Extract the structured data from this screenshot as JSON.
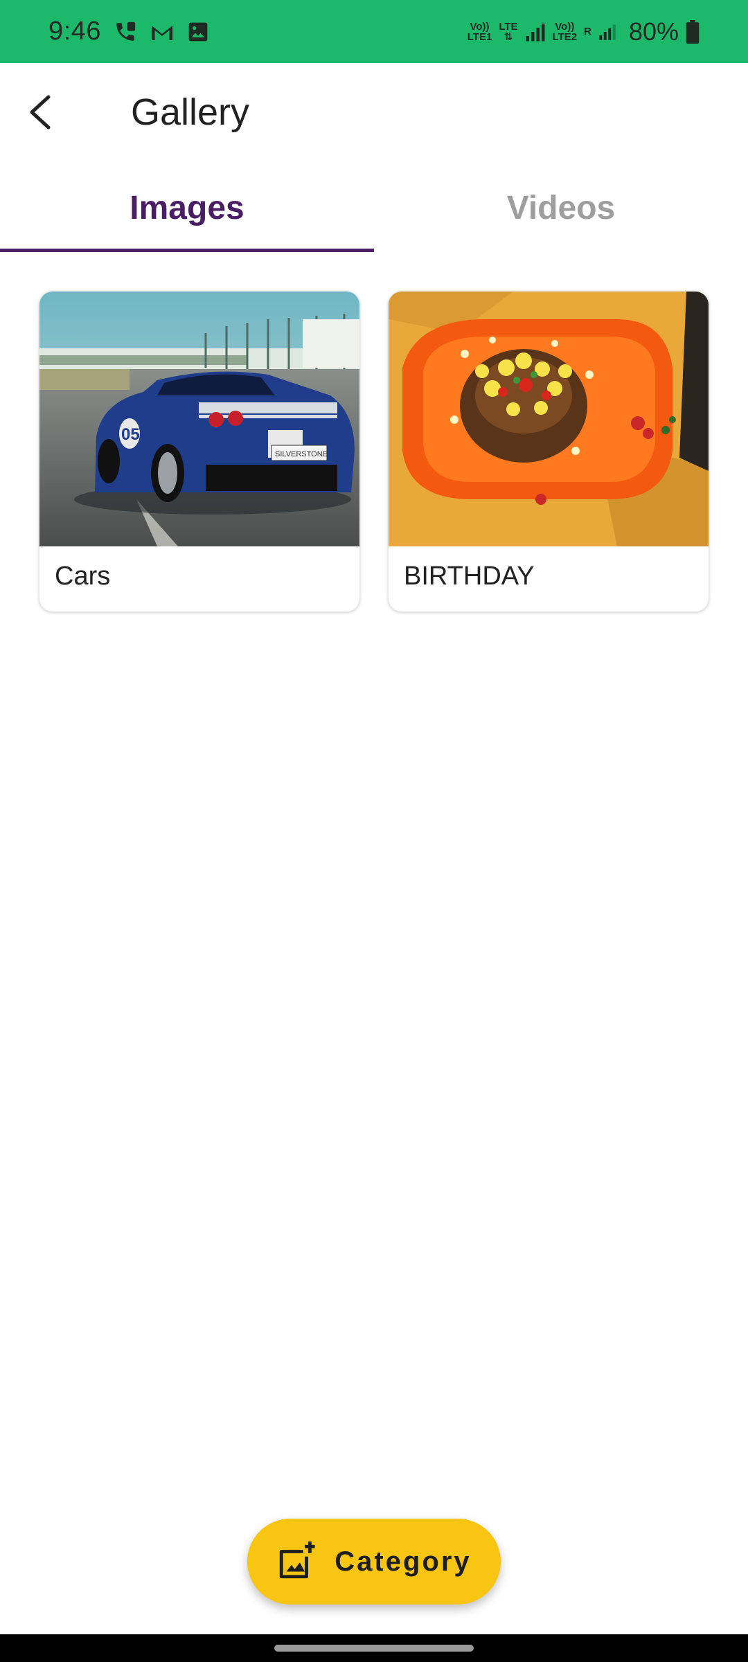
{
  "status_bar": {
    "time": "9:46",
    "sim1_label_top": "Vo))",
    "sim1_label_bottom": "LTE1",
    "lte_label": "LTE",
    "sim2_label_top": "Vo))",
    "sim2_label_bottom": "LTE2",
    "roaming_label": "R",
    "battery_percent": "80%",
    "icons": [
      "call-icon",
      "gmail-icon",
      "image-icon",
      "signal-icon",
      "battery-icon"
    ]
  },
  "app_bar": {
    "title": "Gallery",
    "back_icon": "arrow-back-icon"
  },
  "tabs": {
    "items": [
      {
        "label": "Images",
        "selected": true
      },
      {
        "label": "Videos",
        "selected": false
      }
    ],
    "active_color": "#4a1e64",
    "inactive_color": "#9e9e9e"
  },
  "albums": [
    {
      "label": "Cars",
      "thumbnail": "blue sports car photo"
    },
    {
      "label": "BIRTHDAY",
      "thumbnail": "birthday cake photo"
    }
  ],
  "fab": {
    "label": "Category",
    "icon": "add-photo-icon",
    "color": "#f9c513"
  },
  "colors": {
    "status_bar": "#1cb96b"
  }
}
